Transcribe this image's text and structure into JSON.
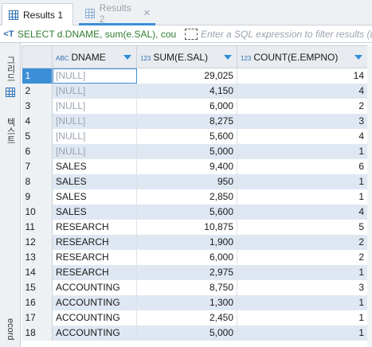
{
  "tabs": [
    {
      "label": "Results 1",
      "active": true
    },
    {
      "label": "Results 2",
      "active": false
    }
  ],
  "filter": {
    "sql": "SELECT d.DNAME, sum(e.SAL), cou",
    "placeholder": "Enter a SQL expression to filter results (u"
  },
  "sidebar": {
    "grid_label": "그리드",
    "text_label": "텍스트",
    "record_label": "ecord"
  },
  "columns": [
    {
      "name": "DNAME",
      "type": "ABC"
    },
    {
      "name": "SUM(E.SAL)",
      "type": "123"
    },
    {
      "name": "COUNT(E.EMPNO)",
      "type": "123"
    }
  ],
  "rows": [
    {
      "n": "1",
      "dname": "[NULL]",
      "sum": "29,025",
      "count": "14"
    },
    {
      "n": "2",
      "dname": "[NULL]",
      "sum": "4,150",
      "count": "4"
    },
    {
      "n": "3",
      "dname": "[NULL]",
      "sum": "6,000",
      "count": "2"
    },
    {
      "n": "4",
      "dname": "[NULL]",
      "sum": "8,275",
      "count": "3"
    },
    {
      "n": "5",
      "dname": "[NULL]",
      "sum": "5,600",
      "count": "4"
    },
    {
      "n": "6",
      "dname": "[NULL]",
      "sum": "5,000",
      "count": "1"
    },
    {
      "n": "7",
      "dname": "SALES",
      "sum": "9,400",
      "count": "6"
    },
    {
      "n": "8",
      "dname": "SALES",
      "sum": "950",
      "count": "1"
    },
    {
      "n": "9",
      "dname": "SALES",
      "sum": "2,850",
      "count": "1"
    },
    {
      "n": "10",
      "dname": "SALES",
      "sum": "5,600",
      "count": "4"
    },
    {
      "n": "11",
      "dname": "RESEARCH",
      "sum": "10,875",
      "count": "5"
    },
    {
      "n": "12",
      "dname": "RESEARCH",
      "sum": "1,900",
      "count": "2"
    },
    {
      "n": "13",
      "dname": "RESEARCH",
      "sum": "6,000",
      "count": "2"
    },
    {
      "n": "14",
      "dname": "RESEARCH",
      "sum": "2,975",
      "count": "1"
    },
    {
      "n": "15",
      "dname": "ACCOUNTING",
      "sum": "8,750",
      "count": "3"
    },
    {
      "n": "16",
      "dname": "ACCOUNTING",
      "sum": "1,300",
      "count": "1"
    },
    {
      "n": "17",
      "dname": "ACCOUNTING",
      "sum": "2,450",
      "count": "1"
    },
    {
      "n": "18",
      "dname": "ACCOUNTING",
      "sum": "5,000",
      "count": "1"
    }
  ]
}
